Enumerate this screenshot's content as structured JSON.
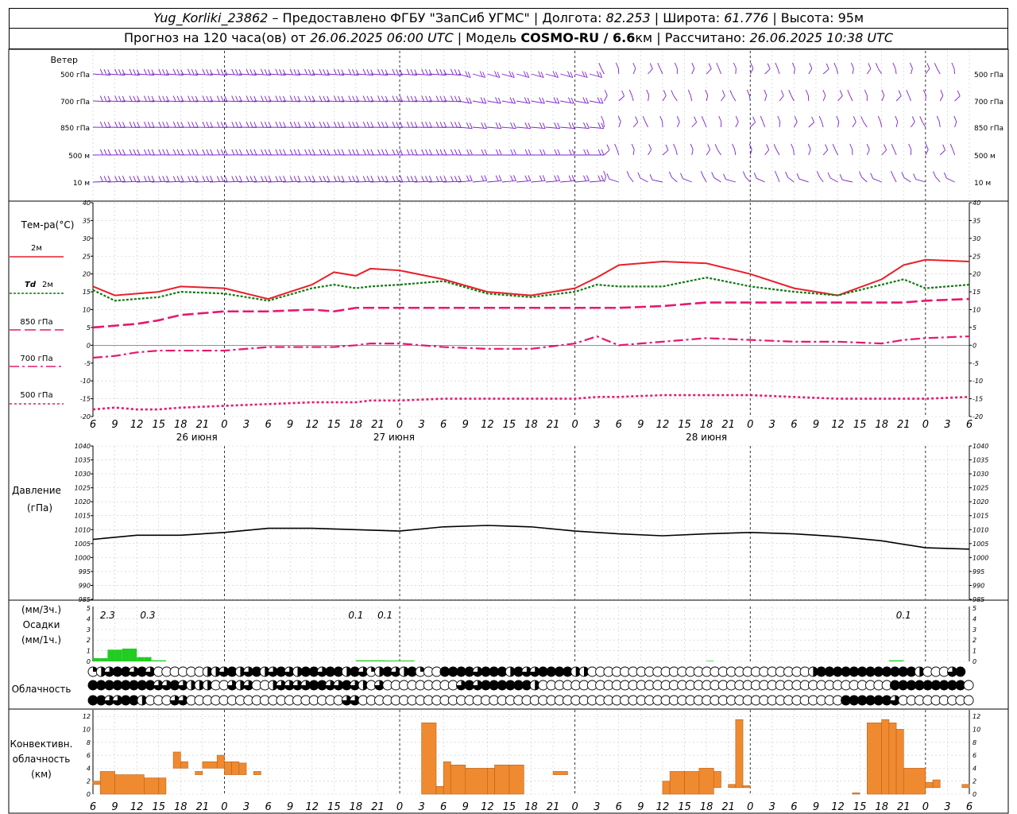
{
  "header": {
    "station": "Yug_Korliki_23862",
    "provider": " – Предоставлено ФГБУ \"ЗапСиб УГМС\" | Долгота: ",
    "lon": "82.253",
    "lat_label": " | Широта: ",
    "lat": "61.776",
    "alt_label": " | Высота: 95м",
    "forecast_prefix": "Прогноз на 120 часа(ов) от ",
    "forecast_start": "26.06.2025 06:00 UTC",
    "model_label": "  | Модель ",
    "model_name": "COSMO-RU / 6.6",
    "model_unit": "км | Рассчитано: ",
    "calc_time": "26.06.2025 10:38 UTC"
  },
  "labels": {
    "wind": "Ветер",
    "wind_levels": [
      "500 гПа",
      "700 гПа",
      "850 гПа",
      "500 м",
      "10  м"
    ],
    "temp": "Тем-ра(°С)",
    "t2m": "2м",
    "td": "Td",
    "td_level": "2м",
    "t850": "850 гПа",
    "t700": "700 гПа",
    "t500": "500 гПа",
    "pressure": "Давление",
    "pressure_unit": "(гПа)",
    "precip_u1": "(мм/3ч.)",
    "precip": "Осадки",
    "precip_u2": "(мм/1ч.)",
    "cloud": "Облачность",
    "conv1": "Конвективн.",
    "conv2": "облачность",
    "conv3": "(км)"
  },
  "days": [
    "26 июня",
    "27 июня",
    "28 июня"
  ],
  "hour_ticks": [
    "6",
    "9",
    "12",
    "15",
    "18",
    "21",
    "0",
    "3",
    "6",
    "9",
    "12",
    "15",
    "18",
    "21",
    "0",
    "3",
    "6",
    "9",
    "12",
    "15",
    "18",
    "21",
    "0",
    "3",
    "6",
    "9",
    "12"
  ],
  "colors": {
    "wind": "#7a1fd0",
    "t2m": "#e8202a",
    "td": "#127a12",
    "t850": "#e6186e",
    "t700": "#e6186e",
    "t500": "#e6186e",
    "pressure": "#000000",
    "precip": "#22cc22",
    "conv": "#f08a30",
    "conv_edge": "#b86018"
  },
  "chart_data": [
    {
      "type": "wind_barbs",
      "levels": [
        "500 гПа",
        "700 гПа",
        "850 гПа",
        "500 м",
        "10 м"
      ],
      "x_hours": [
        0,
        120
      ]
    },
    {
      "type": "line",
      "title": "Тем-ра(°С)",
      "ylim": [
        -20,
        40
      ],
      "x": [
        0,
        3,
        6,
        9,
        12,
        18,
        24,
        30,
        33,
        36,
        38,
        42,
        48,
        54,
        60,
        66,
        69,
        72,
        78,
        84,
        90,
        96,
        102,
        108,
        111,
        114,
        120
      ],
      "series": [
        {
          "name": "2м",
          "values": [
            16.5,
            14,
            14.5,
            15,
            16.5,
            16,
            13,
            17,
            20.5,
            19.5,
            21.5,
            21,
            18.5,
            15,
            14,
            16,
            19,
            22.5,
            23.5,
            23,
            20,
            16,
            14,
            18.5,
            22.5,
            24,
            23.5
          ]
        },
        {
          "name": "Td 2м",
          "values": [
            15.5,
            12.5,
            13,
            13.5,
            15,
            14.5,
            12.5,
            16,
            17,
            16,
            16.5,
            17,
            18,
            14.5,
            13.5,
            15,
            17,
            16.5,
            16.5,
            19,
            16.5,
            15,
            14,
            17,
            18.5,
            16,
            17
          ]
        },
        {
          "name": "850 гПа",
          "values": [
            5,
            5.5,
            6,
            7,
            8.5,
            9.5,
            9.5,
            10,
            9.5,
            10.5,
            10.5,
            10.5,
            10.5,
            10.5,
            10.5,
            10.5,
            10.5,
            10.5,
            11,
            12,
            12,
            12,
            12,
            12,
            12,
            12.5,
            13
          ]
        },
        {
          "name": "700 гПа",
          "values": [
            -3.5,
            -3,
            -2,
            -1.5,
            -1.5,
            -1.5,
            -0.5,
            -0.5,
            -0.5,
            0,
            0.5,
            0.5,
            -0.5,
            -1,
            -1,
            0.5,
            2.5,
            0,
            1,
            2,
            1.5,
            1,
            1,
            0.5,
            1.5,
            2,
            2.5
          ]
        },
        {
          "name": "500 гПа",
          "values": [
            -18,
            -17.5,
            -18,
            -18,
            -17.5,
            -17,
            -16.5,
            -16,
            -16,
            -16,
            -15.5,
            -15.5,
            -15,
            -15,
            -15,
            -15,
            -14.5,
            -14.5,
            -14,
            -14,
            -14,
            -14.5,
            -15,
            -15,
            -15,
            -15,
            -14.5
          ]
        }
      ]
    },
    {
      "type": "line",
      "title": "Давление",
      "ylabel": "(гПа)",
      "ylim": [
        985,
        1040
      ],
      "x": [
        0,
        6,
        12,
        18,
        24,
        30,
        36,
        42,
        48,
        54,
        60,
        66,
        72,
        78,
        84,
        90,
        96,
        102,
        108,
        114,
        120
      ],
      "values": [
        1006.5,
        1008,
        1008,
        1009,
        1010.5,
        1010.5,
        1010,
        1009.5,
        1011,
        1011.5,
        1011,
        1009.5,
        1008.5,
        1007.8,
        1008.5,
        1009,
        1008.5,
        1007.5,
        1006,
        1003.5,
        1003
      ]
    },
    {
      "type": "bar",
      "title": "Осадки",
      "ylim": [
        0,
        5
      ],
      "annotations": [
        "2.3",
        "0.3",
        "0.1",
        "0.1",
        "0.1"
      ],
      "x": [
        0,
        1,
        2,
        3,
        4,
        5,
        6,
        7,
        8,
        9,
        10,
        11,
        12,
        13,
        14,
        15,
        16,
        17,
        18,
        19,
        20,
        21,
        22,
        23,
        24,
        25,
        26,
        27,
        28,
        29,
        30,
        31,
        32,
        33,
        34,
        35,
        36,
        37,
        38,
        39,
        40,
        41,
        42,
        43,
        44,
        45,
        46,
        47,
        48,
        49,
        50,
        51,
        52,
        53,
        54,
        55,
        56,
        57,
        58,
        59,
        60,
        61,
        62,
        63,
        64,
        65,
        66,
        67,
        68,
        69,
        70,
        71,
        72,
        73,
        74,
        75,
        76,
        77,
        78,
        79,
        80,
        81,
        82,
        83,
        84,
        85,
        86,
        87,
        88,
        89,
        90,
        91,
        92,
        93,
        94,
        95,
        96,
        97,
        98,
        99,
        100,
        101,
        102,
        103,
        104,
        105,
        106,
        107,
        108,
        109,
        110,
        111,
        112,
        113,
        114,
        115,
        116,
        117,
        118,
        119
      ],
      "values": [
        0.3,
        0.3,
        1.1,
        1.1,
        1.2,
        1.2,
        0.4,
        0.4,
        0.1,
        0.1,
        0,
        0,
        0,
        0,
        0,
        0,
        0,
        0,
        0,
        0,
        0,
        0,
        0,
        0,
        0,
        0,
        0,
        0,
        0,
        0,
        0,
        0,
        0,
        0,
        0,
        0,
        0.1,
        0.1,
        0.1,
        0.1,
        0.08,
        0.08,
        0.08,
        0.08,
        0,
        0,
        0,
        0,
        0,
        0,
        0,
        0,
        0,
        0,
        0,
        0,
        0,
        0,
        0,
        0,
        0,
        0,
        0,
        0,
        0,
        0,
        0,
        0,
        0,
        0,
        0,
        0,
        0,
        0,
        0,
        0,
        0,
        0,
        0,
        0,
        0,
        0,
        0,
        0,
        0.05,
        0,
        0,
        0,
        0,
        0,
        0,
        0,
        0,
        0,
        0,
        0,
        0,
        0,
        0,
        0,
        0,
        0,
        0,
        0,
        0,
        0,
        0,
        0,
        0,
        0.1,
        0.1,
        0,
        0,
        0,
        0,
        0,
        0,
        0,
        0,
        0
      ]
    },
    {
      "type": "cloud_cover",
      "title": "Облачность",
      "rows": 3,
      "cover_levels": [
        [
          1,
          2,
          3,
          4,
          4,
          3,
          4,
          3,
          0,
          0,
          0,
          0,
          0,
          0,
          2,
          2,
          3,
          4,
          2,
          3,
          4,
          2,
          3,
          4,
          3,
          2,
          4,
          4,
          3,
          4,
          4,
          2,
          4,
          3,
          1,
          2,
          4,
          3,
          2,
          4,
          1,
          0,
          0,
          4,
          4,
          4,
          4,
          3,
          4,
          4,
          4,
          2,
          4,
          3,
          3,
          4,
          4,
          4,
          4,
          2,
          2,
          0,
          0,
          0,
          0,
          0,
          0,
          0,
          0,
          0,
          0,
          0,
          0,
          0,
          0,
          0,
          0,
          0,
          0,
          0,
          0,
          0,
          0,
          0,
          0,
          0,
          0,
          0,
          2,
          4,
          4,
          4,
          4,
          4,
          4,
          4,
          4,
          4,
          4,
          4,
          4,
          2,
          0,
          0,
          0,
          3,
          4
        ],
        [
          4,
          4,
          4,
          4,
          4,
          4,
          4,
          4,
          3,
          3,
          4,
          3,
          2,
          2,
          2,
          0,
          0,
          3,
          2,
          3,
          0,
          0,
          2,
          3,
          3,
          3,
          3,
          4,
          4,
          3,
          3,
          4,
          3,
          2,
          0,
          3,
          0,
          0,
          0,
          0,
          0,
          0,
          0,
          0,
          0,
          3,
          4,
          3,
          4,
          4,
          4,
          4,
          4,
          4,
          2,
          0,
          0,
          0,
          0,
          0,
          0,
          0,
          0,
          0,
          0,
          0,
          0,
          0,
          0,
          0,
          0,
          0,
          0,
          0,
          0,
          0,
          0,
          0,
          0,
          0,
          0,
          0,
          0,
          0,
          0,
          0,
          0,
          0,
          0,
          0,
          0,
          0,
          0,
          0,
          0,
          0,
          0,
          0,
          4,
          4,
          4,
          4,
          4,
          4,
          4,
          4,
          4,
          0,
          0,
          0,
          0,
          0,
          0,
          0,
          0,
          0,
          0
        ],
        [
          4,
          4,
          3,
          3,
          4,
          4,
          2,
          0,
          0,
          0,
          3,
          3,
          0,
          0,
          0,
          0,
          0,
          0,
          0,
          0,
          0,
          0,
          0,
          0,
          0,
          0,
          0,
          0,
          0,
          0,
          0,
          3,
          3,
          0,
          0,
          0,
          0,
          0,
          0,
          0,
          0,
          0,
          0,
          0,
          0,
          0,
          0,
          0,
          0,
          0,
          0,
          0,
          0,
          0,
          0,
          0,
          0,
          0,
          0,
          0,
          0,
          0,
          0,
          0,
          0,
          0,
          0,
          0,
          0,
          0,
          0,
          0,
          0,
          0,
          0,
          0,
          0,
          0,
          0,
          0,
          0,
          0,
          0,
          0,
          0,
          0,
          0,
          0,
          0,
          0,
          0,
          0,
          4,
          4,
          4,
          4,
          4,
          4,
          3,
          0,
          0,
          0,
          0,
          0,
          0,
          0,
          0,
          0,
          0,
          0,
          0,
          0,
          0,
          0,
          0,
          0,
          0
        ]
      ]
    },
    {
      "type": "bar",
      "title": "Конвективн. облачность",
      "ylabel": "(км)",
      "ylim": [
        0,
        13
      ],
      "bars": [
        {
          "x0": 0,
          "x1": 1,
          "lo": 1.5,
          "hi": 2
        },
        {
          "x0": 1,
          "x1": 3,
          "lo": 0,
          "hi": 3.5
        },
        {
          "x0": 3,
          "x1": 7,
          "lo": 0,
          "hi": 3
        },
        {
          "x0": 7,
          "x1": 9,
          "lo": 0,
          "hi": 2.5
        },
        {
          "x0": 9,
          "x1": 10,
          "lo": 0,
          "hi": 2.5
        },
        {
          "x0": 11,
          "x1": 12,
          "lo": 4,
          "hi": 6.5
        },
        {
          "x0": 12,
          "x1": 13,
          "lo": 4,
          "hi": 5
        },
        {
          "x0": 14,
          "x1": 15,
          "lo": 3,
          "hi": 3.5
        },
        {
          "x0": 15,
          "x1": 17,
          "lo": 4,
          "hi": 5
        },
        {
          "x0": 17,
          "x1": 18,
          "lo": 4,
          "hi": 6
        },
        {
          "x0": 18,
          "x1": 19,
          "lo": 3,
          "hi": 5
        },
        {
          "x0": 19,
          "x1": 20,
          "lo": 3,
          "hi": 5
        },
        {
          "x0": 20,
          "x1": 21,
          "lo": 3,
          "hi": 4.8
        },
        {
          "x0": 22,
          "x1": 23,
          "lo": 3,
          "hi": 3.5
        },
        {
          "x0": 45,
          "x1": 47,
          "lo": 0,
          "hi": 11
        },
        {
          "x0": 47,
          "x1": 48,
          "lo": 0,
          "hi": 1.2
        },
        {
          "x0": 48,
          "x1": 49,
          "lo": 0,
          "hi": 5
        },
        {
          "x0": 49,
          "x1": 51,
          "lo": 0,
          "hi": 4.5
        },
        {
          "x0": 51,
          "x1": 54,
          "lo": 0,
          "hi": 4
        },
        {
          "x0": 54,
          "x1": 55,
          "lo": 0,
          "hi": 4
        },
        {
          "x0": 55,
          "x1": 57,
          "lo": 0,
          "hi": 4.5
        },
        {
          "x0": 57,
          "x1": 59,
          "lo": 0,
          "hi": 4.5
        },
        {
          "x0": 63,
          "x1": 65,
          "lo": 3,
          "hi": 3.5
        },
        {
          "x0": 78,
          "x1": 79,
          "lo": 0,
          "hi": 2
        },
        {
          "x0": 79,
          "x1": 81,
          "lo": 0,
          "hi": 3.5
        },
        {
          "x0": 81,
          "x1": 83,
          "lo": 0,
          "hi": 3.5
        },
        {
          "x0": 83,
          "x1": 85,
          "lo": 0,
          "hi": 4
        },
        {
          "x0": 85,
          "x1": 86,
          "lo": 1,
          "hi": 3.5
        },
        {
          "x0": 87,
          "x1": 88,
          "lo": 1,
          "hi": 1.5
        },
        {
          "x0": 88,
          "x1": 89,
          "lo": 1,
          "hi": 11.5
        },
        {
          "x0": 89,
          "x1": 90,
          "lo": 1,
          "hi": 1.3
        },
        {
          "x0": 104,
          "x1": 105,
          "lo": 0,
          "hi": 0.2
        },
        {
          "x0": 106,
          "x1": 108,
          "lo": 0,
          "hi": 11
        },
        {
          "x0": 108,
          "x1": 109,
          "lo": 0,
          "hi": 11.5
        },
        {
          "x0": 109,
          "x1": 110,
          "lo": 0,
          "hi": 11
        },
        {
          "x0": 110,
          "x1": 111,
          "lo": 0,
          "hi": 10
        },
        {
          "x0": 111,
          "x1": 114,
          "lo": 0,
          "hi": 4
        },
        {
          "x0": 114,
          "x1": 115,
          "lo": 1,
          "hi": 1.8
        },
        {
          "x0": 115,
          "x1": 116,
          "lo": 1,
          "hi": 2.2
        },
        {
          "x0": 119,
          "x1": 120,
          "lo": 1,
          "hi": 1.5
        }
      ]
    }
  ]
}
